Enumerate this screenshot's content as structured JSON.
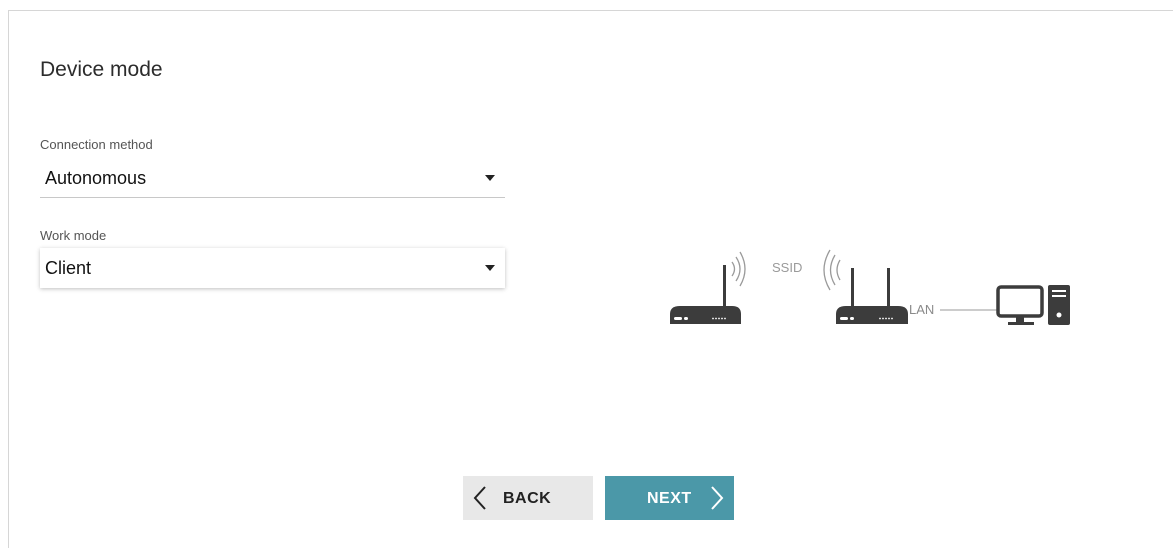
{
  "page": {
    "title": "Device mode"
  },
  "connection_method": {
    "label": "Connection method",
    "value": "Autonomous"
  },
  "work_mode": {
    "label": "Work mode",
    "value": "Client"
  },
  "diagram": {
    "ssid_label": "SSID",
    "lan_label": "LAN",
    "icons": [
      "router-icon",
      "wifi-waves-icon",
      "router-icon",
      "computer-icon"
    ]
  },
  "buttons": {
    "back_label": "BACK",
    "next_label": "NEXT"
  },
  "colors": {
    "accent": "#4b98a8",
    "back_button_bg": "#e8e8e8",
    "icon_dark": "#3c3c3c",
    "icon_light": "#9a9a9a"
  }
}
